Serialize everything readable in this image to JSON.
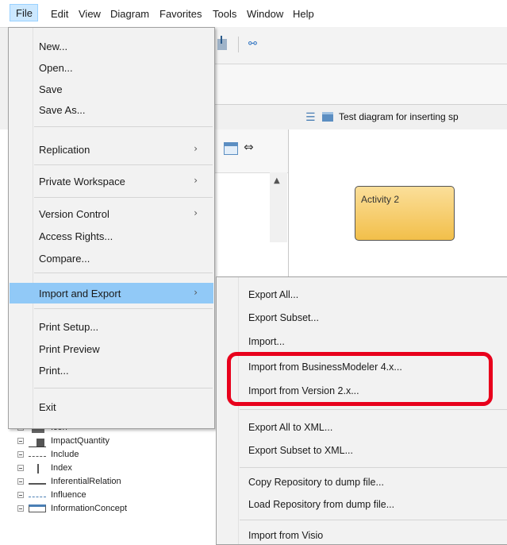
{
  "menubar": {
    "items": [
      "File",
      "Edit",
      "View",
      "Diagram",
      "Favorites",
      "Tools",
      "Window",
      "Help"
    ]
  },
  "toolbar": {
    "link_glyph": "⚯"
  },
  "tab": {
    "title": "Test diagram for inserting sp"
  },
  "canvas": {
    "activity_label": "Activity 2"
  },
  "file_menu": {
    "items": [
      {
        "label": "New..."
      },
      {
        "label": "Open..."
      },
      {
        "label": "Save"
      },
      {
        "label": "Save As..."
      },
      {
        "label": "Replication",
        "submenu": true
      },
      {
        "label": "Private Workspace",
        "submenu": true
      },
      {
        "label": "Version Control",
        "submenu": true
      },
      {
        "label": "Access Rights..."
      },
      {
        "label": "Compare..."
      },
      {
        "label": "Import and Export",
        "submenu": true,
        "highlighted": true
      },
      {
        "label": "Print Setup..."
      },
      {
        "label": "Print Preview"
      },
      {
        "label": "Print..."
      },
      {
        "label": "Exit"
      }
    ],
    "arrow": "›"
  },
  "submenu": {
    "items": [
      "Export All...",
      "Export Subset...",
      "Import...",
      "Import from BusinessModeler 4.x...",
      "Import from Version 2.x...",
      "Export All to XML...",
      "Export Subset to XML...",
      "Copy Repository to dump file...",
      "Load Repository from dump file...",
      "Import from Visio"
    ]
  },
  "tree": {
    "items": [
      "Icon",
      "ImpactQuantity",
      "Include",
      "Index",
      "InferentialRelation",
      "Influence",
      "InformationConcept"
    ]
  },
  "colors": {
    "menu_highlight": "#91c9f7",
    "annotation_red": "#e8001c",
    "activity_fill": "#f2bf4a"
  }
}
